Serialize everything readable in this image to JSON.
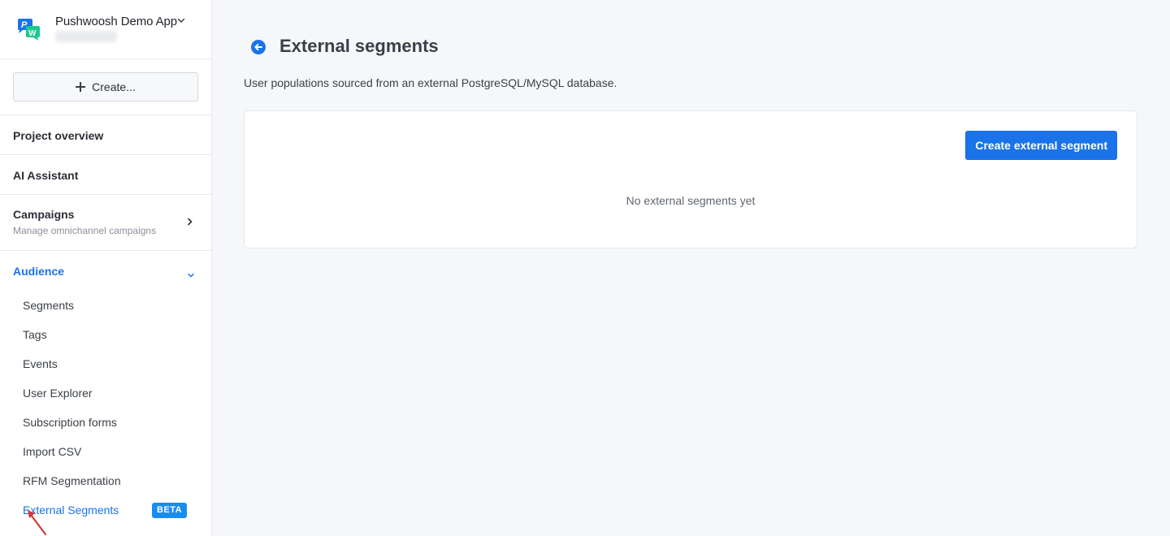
{
  "app": {
    "name": "Pushwoosh Demo App",
    "logo_icon": "pushwoosh-logo-icon",
    "switcher_icon": "chevron-down-icon"
  },
  "sidebar": {
    "create_label": "Create...",
    "create_icon": "plus-icon",
    "items": [
      {
        "label": "Project overview"
      },
      {
        "label": "AI Assistant"
      },
      {
        "label": "Campaigns",
        "subtitle": "Manage omnichannel campaigns",
        "icon": "chevron-right-icon"
      }
    ],
    "audience": {
      "label": "Audience",
      "icon": "chevron-down-icon",
      "expanded": true,
      "children": [
        {
          "label": "Segments"
        },
        {
          "label": "Tags"
        },
        {
          "label": "Events"
        },
        {
          "label": "User Explorer"
        },
        {
          "label": "Subscription forms"
        },
        {
          "label": "Import CSV"
        },
        {
          "label": "RFM Segmentation"
        },
        {
          "label": "External Segments",
          "badge": "BETA",
          "active": true
        }
      ]
    }
  },
  "main": {
    "back_icon": "arrow-left-circle-icon",
    "title": "External segments",
    "description": "User populations sourced from an external PostgreSQL/MySQL database.",
    "create_button": "Create external segment",
    "empty_state": "No external segments yet"
  },
  "colors": {
    "accent": "#1a73e8",
    "badge": "#1a8cf0",
    "background": "#f6f7f9",
    "cursor": "#d23a3a"
  }
}
